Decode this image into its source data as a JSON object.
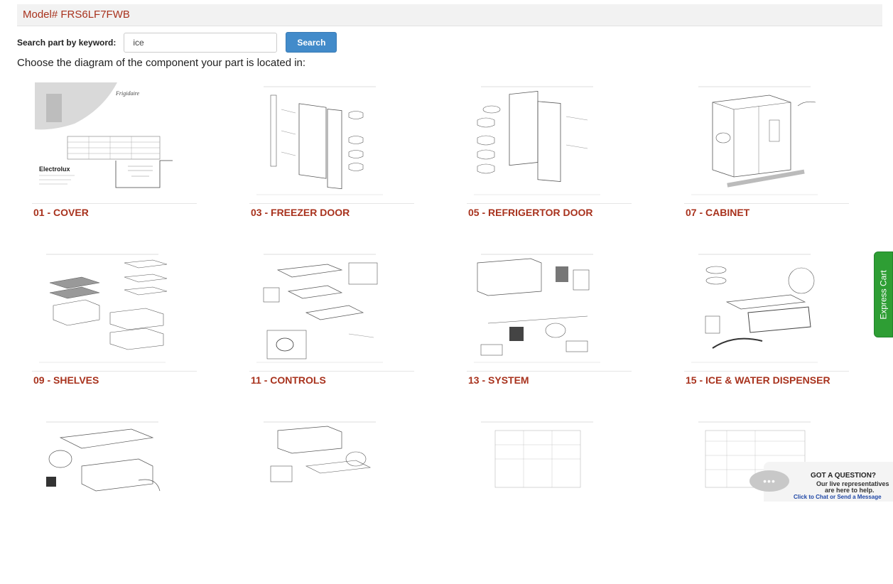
{
  "header": {
    "model_title": "Model# FRS6LF7FWB"
  },
  "search": {
    "label": "Search part by keyword:",
    "value": "ice",
    "button_label": "Search"
  },
  "instruction": "Choose the diagram of the component your part is located in:",
  "diagrams": [
    {
      "title": "01 - COVER"
    },
    {
      "title": "03 - FREEZER DOOR"
    },
    {
      "title": "05 - REFRIGERTOR DOOR"
    },
    {
      "title": "07 - CABINET"
    },
    {
      "title": "09 - SHELVES"
    },
    {
      "title": "11 - CONTROLS"
    },
    {
      "title": "13 - SYSTEM"
    },
    {
      "title": "15 - ICE & WATER DISPENSER"
    },
    {
      "title": ""
    },
    {
      "title": ""
    },
    {
      "title": ""
    },
    {
      "title": ""
    }
  ],
  "cover_text": {
    "brand": "Electrolux"
  },
  "express_cart": {
    "label": "Express Cart"
  },
  "chat": {
    "title": "GOT A QUESTION?",
    "line1": "Our live representatives",
    "line2": "are here to help.",
    "link": "Click to Chat or Send a Message",
    "bubble_icon": "•••"
  },
  "colors": {
    "accent": "#a8321d",
    "button": "#428bca",
    "cart": "#2e9e34"
  }
}
